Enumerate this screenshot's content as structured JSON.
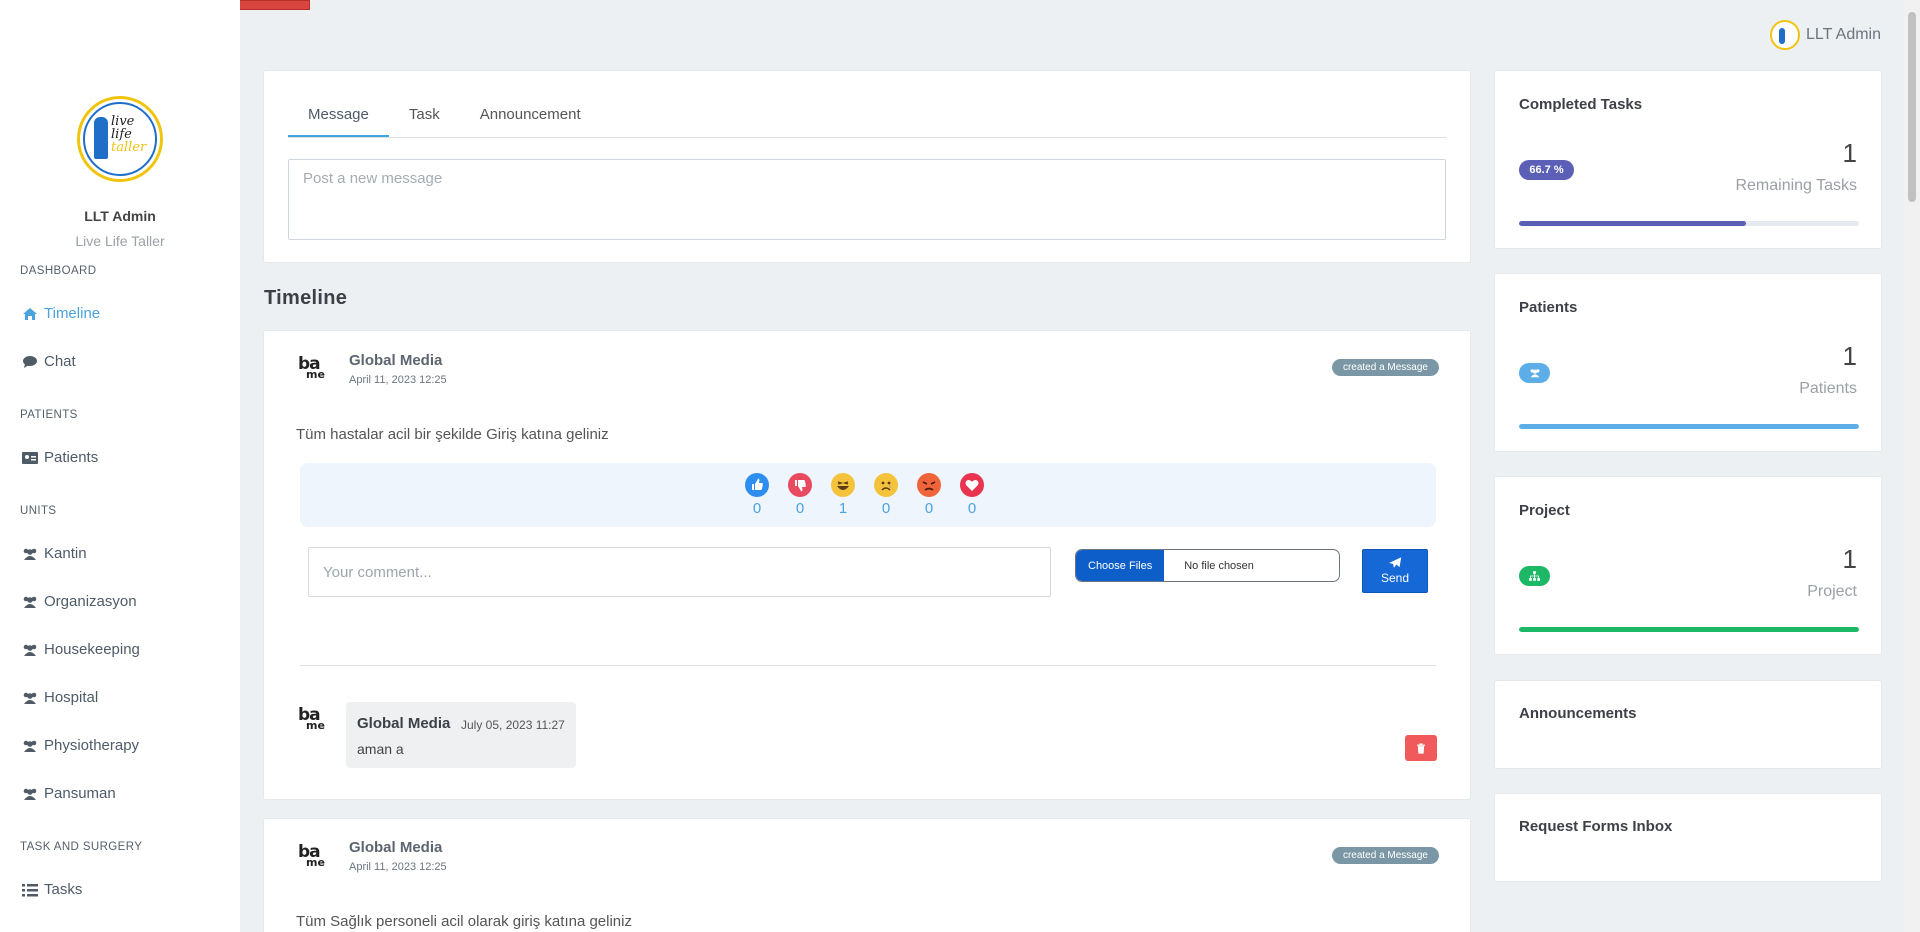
{
  "header": {
    "user_name": "LLT Admin"
  },
  "sidebar": {
    "logo_text": [
      "live",
      "life",
      "taller"
    ],
    "user_name": "LLT Admin",
    "user_subtitle": "Live Life Taller",
    "sections": {
      "dashboard": "DASHBOARD",
      "patients": "PATIENTS",
      "units": "UNITS",
      "task_surgery": "TASK AND SURGERY"
    },
    "items": {
      "timeline": "Timeline",
      "chat": "Chat",
      "patients": "Patients",
      "kantin": "Kantin",
      "organizasyon": "Organizasyon",
      "housekeeping": "Housekeeping",
      "hospital": "Hospital",
      "physiotherapy": "Physiotherapy",
      "pansuman": "Pansuman",
      "tasks": "Tasks"
    }
  },
  "composer": {
    "tabs": [
      "Message",
      "Task",
      "Announcement"
    ],
    "placeholder": "Post a new message"
  },
  "timeline_title": "Timeline",
  "posts": [
    {
      "author": "Global Media",
      "date": "April 11, 2023 12:25",
      "badge": "created a Message",
      "text": "Tüm hastalar acil bir şekilde Giriş katına geliniz",
      "reactions": [
        {
          "icon": "like-icon",
          "count": "0",
          "color": "#2d8ef0"
        },
        {
          "icon": "dislike-icon",
          "count": "0",
          "color": "#e84a5f"
        },
        {
          "icon": "laugh-icon",
          "count": "1",
          "color": "#f5c33b"
        },
        {
          "icon": "sad-icon",
          "count": "0",
          "color": "#f5c33b"
        },
        {
          "icon": "angry-icon",
          "count": "0",
          "color": "#f0643c"
        },
        {
          "icon": "love-icon",
          "count": "0",
          "color": "#e8344f"
        }
      ],
      "comment_placeholder": "Your comment...",
      "file_button": "Choose Files",
      "file_status": "No file chosen",
      "send_label": "Send",
      "comment": {
        "author": "Global Media",
        "date": "July 05, 2023 11:27",
        "text": "aman a"
      }
    },
    {
      "author": "Global Media",
      "date": "April 11, 2023 12:25",
      "badge": "created a Message",
      "text": "Tüm Sağlık personeli acil olarak giriş katına geliniz"
    }
  ],
  "stats": {
    "completed": {
      "title": "Completed Tasks",
      "pill": "66.7 %",
      "value": "1",
      "label": "Remaining Tasks",
      "progress": 0.667,
      "color": "#5b5fb5"
    },
    "patients": {
      "title": "Patients",
      "value": "1",
      "label": "Patients",
      "progress": 1.0,
      "color": "#5daee8"
    },
    "project": {
      "title": "Project",
      "value": "1",
      "label": "Project",
      "progress": 1.0,
      "color": "#1db866"
    },
    "announcements": {
      "title": "Announcements"
    },
    "request_forms": {
      "title": "Request Forms Inbox"
    }
  }
}
